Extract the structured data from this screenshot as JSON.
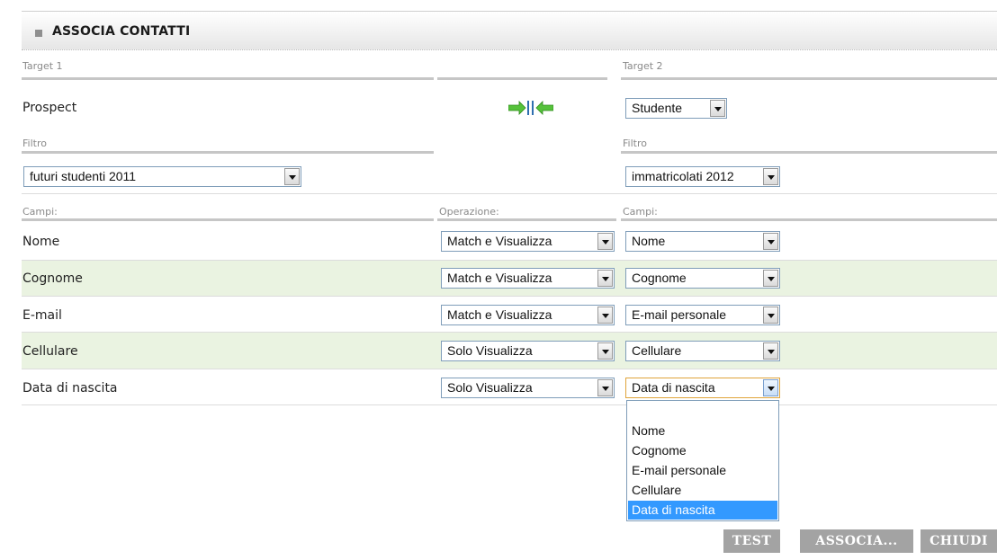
{
  "panel": {
    "title": "ASSOCIA CONTATTI"
  },
  "target1": {
    "label": "Target 1",
    "value": "Prospect"
  },
  "target2": {
    "label": "Target 2",
    "selected": "Studente"
  },
  "filter1": {
    "label": "Filtro",
    "selected": "futuri studenti 2011"
  },
  "filter2": {
    "label": "Filtro",
    "selected": "immatricolati 2012"
  },
  "columns": {
    "fields1": "Campi:",
    "operation": "Operazione:",
    "fields2": "Campi:"
  },
  "rows": [
    {
      "field": "Nome",
      "operation": "Match e Visualizza",
      "target_field": "Nome"
    },
    {
      "field": "Cognome",
      "operation": "Match e Visualizza",
      "target_field": "Cognome"
    },
    {
      "field": "E-mail",
      "operation": "Match e Visualizza",
      "target_field": "E-mail personale"
    },
    {
      "field": "Cellulare",
      "operation": "Solo Visualizza",
      "target_field": "Cellulare"
    },
    {
      "field": "Data di nascita",
      "operation": "Solo Visualizza",
      "target_field": "Data di nascita"
    }
  ],
  "dropdown": {
    "options": [
      "",
      "Nome",
      "Cognome",
      "E-mail personale",
      "Cellulare",
      "Data di nascita"
    ],
    "selected_index": 5
  },
  "buttons": {
    "test": "TEST",
    "associa": "ASSOCIA...",
    "chiudi": "CHIUDI"
  },
  "colors": {
    "row_highlight": "#eaf3e1",
    "arrow": "#55c23a",
    "button_bg": "#a3a3a3",
    "option_selected": "#3399ff"
  },
  "icons": {
    "associate": "merge-arrows-icon",
    "panel_marker": "square-bullet-icon"
  }
}
